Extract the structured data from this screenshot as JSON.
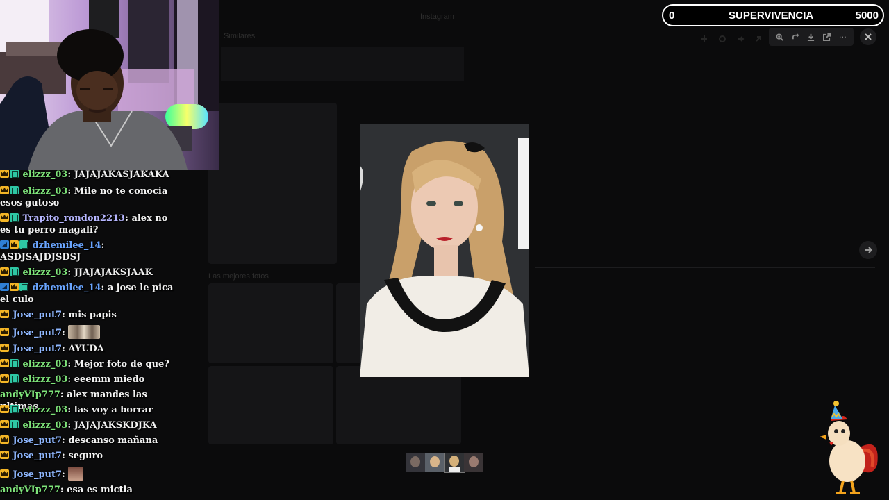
{
  "background_page": {
    "tab_title": "Instagram",
    "section_label": "Similares",
    "section_label2": "Las mejores fotos"
  },
  "viewer": {
    "toolbar_icons": [
      "zoom-in-icon",
      "rotate-icon",
      "download-icon",
      "open-external-icon",
      "more-icon"
    ],
    "close_icon": "close-icon",
    "next_icon": "arrow-right-icon"
  },
  "counter": {
    "current": "0",
    "title": "SUPERVIVENCIA",
    "goal": "5000"
  },
  "chat": {
    "messages": [
      {
        "user": "elizzz_03",
        "text": "JAJAJAKASJAKAKA"
      },
      {
        "user": "elizzz_03",
        "text": "Mile no te conocia esos gutoso"
      },
      {
        "user": "Trapito_rondon2213",
        "text": "alex no es tu perro magali?"
      },
      {
        "user": "dzhemilee_14",
        "text": "ASDJSAJDJSDSJ"
      },
      {
        "user": "elizzz_03",
        "text": "JJAJAJAKSJAAK"
      },
      {
        "user": "dzhemilee_14",
        "text": "a jose le pica el culo"
      },
      {
        "user": "Jose_put7",
        "text": "mis papis"
      },
      {
        "user": "Jose_put7",
        "text": ""
      },
      {
        "user": "Jose_put7",
        "text": "AYUDA"
      },
      {
        "user": "elizzz_03",
        "text": "Mejor foto de que?"
      },
      {
        "user": "elizzz_03",
        "text": "eeemm miedo"
      },
      {
        "user": "andyVIp777",
        "text": "alex mandes las ultimas"
      },
      {
        "user": "elizzz_03",
        "text": "las voy a borrar"
      },
      {
        "user": "elizzz_03",
        "text": "JAJAJAKSKDJKA"
      },
      {
        "user": "Jose_put7",
        "text": "descanso mañana"
      },
      {
        "user": "Jose_put7",
        "text": "seguro"
      },
      {
        "user": "Jose_put7",
        "text": ""
      },
      {
        "user": "andyVIp777",
        "text": "esa es mictia"
      }
    ]
  },
  "colors": {
    "counter_border": "#ffffff",
    "chat_green": "#7ee37a",
    "chat_blue": "#6aa5ff",
    "overlay_bg": "#060606"
  }
}
